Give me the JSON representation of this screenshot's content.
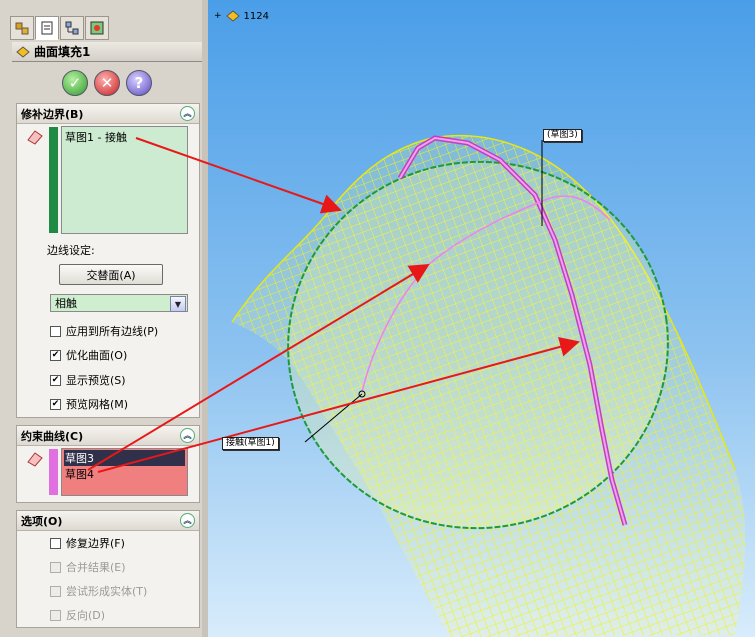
{
  "feature": {
    "title": "曲面填充1"
  },
  "tree": {
    "item_label": "1124"
  },
  "buttons": {
    "ok": "✓",
    "cancel": "✕",
    "help": "?"
  },
  "patch_boundary": {
    "header": "修补边界(B)",
    "items": [
      "草图1 - 接触"
    ],
    "edge_settings_label": "边线设定:",
    "alternate_face_button": "交替面(A)",
    "continuity_select": "相触",
    "options": [
      {
        "label": "应用到所有边线(P)",
        "checked": false
      },
      {
        "label": "优化曲面(O)",
        "checked": true
      },
      {
        "label": "显示预览(S)",
        "checked": true
      },
      {
        "label": "预览网格(M)",
        "checked": true
      }
    ]
  },
  "constraint_curves": {
    "header": "约束曲线(C)",
    "items": [
      "草图3",
      "草图4"
    ]
  },
  "options_group": {
    "header": "选项(O)",
    "options": [
      {
        "label": "修复边界(F)",
        "checked": false,
        "enabled": true
      },
      {
        "label": "合并结果(E)",
        "checked": false,
        "enabled": false
      },
      {
        "label": "尝试形成实体(T)",
        "checked": false,
        "enabled": false
      },
      {
        "label": "反向(D)",
        "checked": false,
        "enabled": false
      }
    ]
  },
  "viewport": {
    "callout_sketch3": "(草图3)",
    "callout_contact": "接触(草图1)"
  },
  "colors": {
    "surface_mesh": "#f2f21a",
    "boundary_green": "#1e9a3a",
    "constraint_pink": "#e060e0",
    "arrow_red": "#e81818",
    "selection_pink": "#f08080"
  }
}
